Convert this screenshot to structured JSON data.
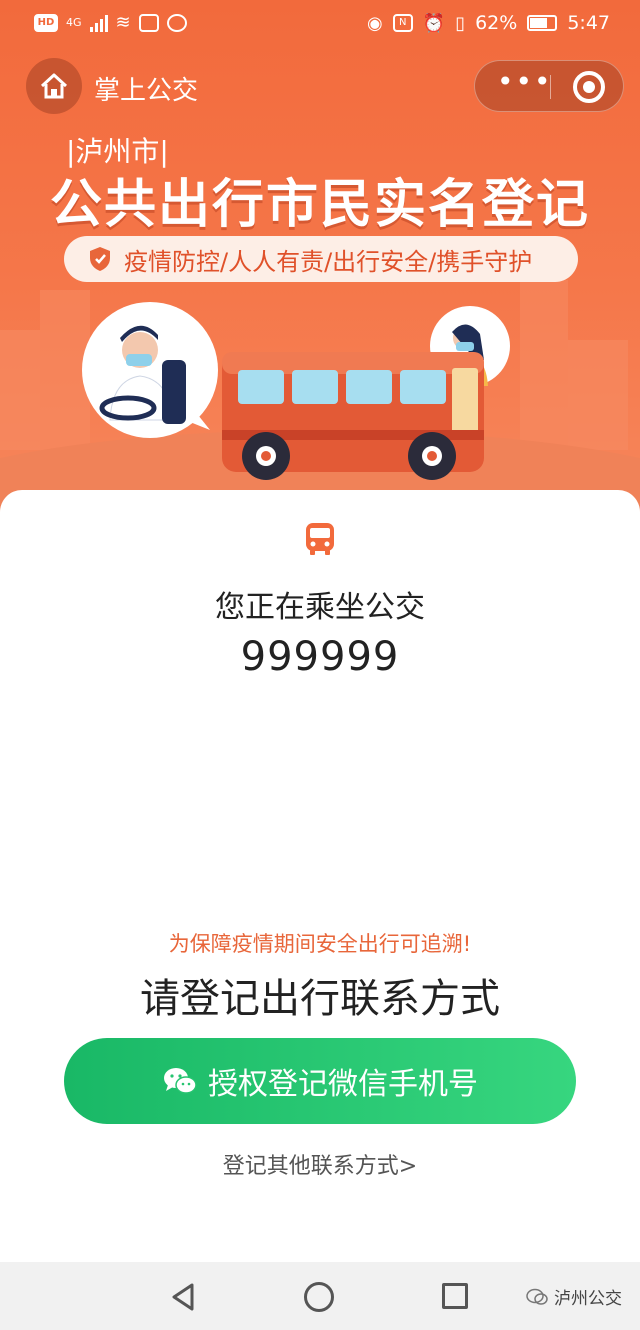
{
  "status_bar": {
    "hd": "HD",
    "network": "4G",
    "battery": "62%",
    "time": "5:47"
  },
  "nav": {
    "title": "掌上公交"
  },
  "banner": {
    "city": "|泸州市|",
    "headline": "公共出行市民实名登记",
    "slogan": "疫情防控/人人有责/出行安全/携手守护"
  },
  "card": {
    "riding_text": "您正在乘坐公交",
    "bus_number": "999999",
    "notice": "为保障疫情期间安全出行可追溯!",
    "register_title": "请登记出行联系方式",
    "auth_button": "授权登记微信手机号",
    "other_link": "登记其他联系方式>"
  },
  "watermark": {
    "text": "泸州公交"
  },
  "colors": {
    "brand_orange": "#f26a3c",
    "button_green": "#19b866",
    "notice_orange": "#e8663a"
  }
}
